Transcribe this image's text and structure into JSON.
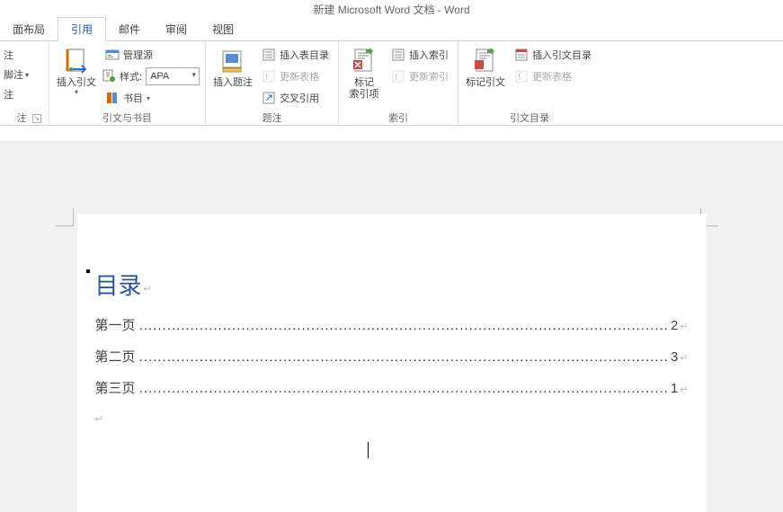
{
  "window": {
    "title": "新建 Microsoft Word 文档 - Word"
  },
  "tabs": {
    "layout": "面布局",
    "references": "引用",
    "mailings": "邮件",
    "review": "审阅",
    "view": "视图"
  },
  "ribbon": {
    "footnotes": {
      "partial1": "注",
      "partial2": "脚注",
      "partial3": "注",
      "group_label": "注"
    },
    "citations": {
      "insert_citation": "插入引文",
      "manage_sources": "管理源",
      "style_label": "样式:",
      "style_value": "APA",
      "bibliography": "书目",
      "group_label": "引文与书目"
    },
    "captions": {
      "insert_caption": "插入题注",
      "insert_tof": "插入表目录",
      "update_table": "更新表格",
      "cross_ref": "交叉引用",
      "group_label": "题注"
    },
    "index": {
      "mark_entry_l1": "标记",
      "mark_entry_l2": "索引项",
      "insert_index": "插入索引",
      "update_index": "更新索引",
      "group_label": "索引"
    },
    "toa": {
      "mark_citation": "标记引文",
      "insert_toa": "插入引文目录",
      "update_toa": "更新表格",
      "group_label": "引文目录"
    }
  },
  "document": {
    "toc_title": "目录",
    "entries": [
      {
        "label": "第一页",
        "page": "2"
      },
      {
        "label": "第二页",
        "page": "3"
      },
      {
        "label": "第三页",
        "page": "1"
      }
    ]
  }
}
